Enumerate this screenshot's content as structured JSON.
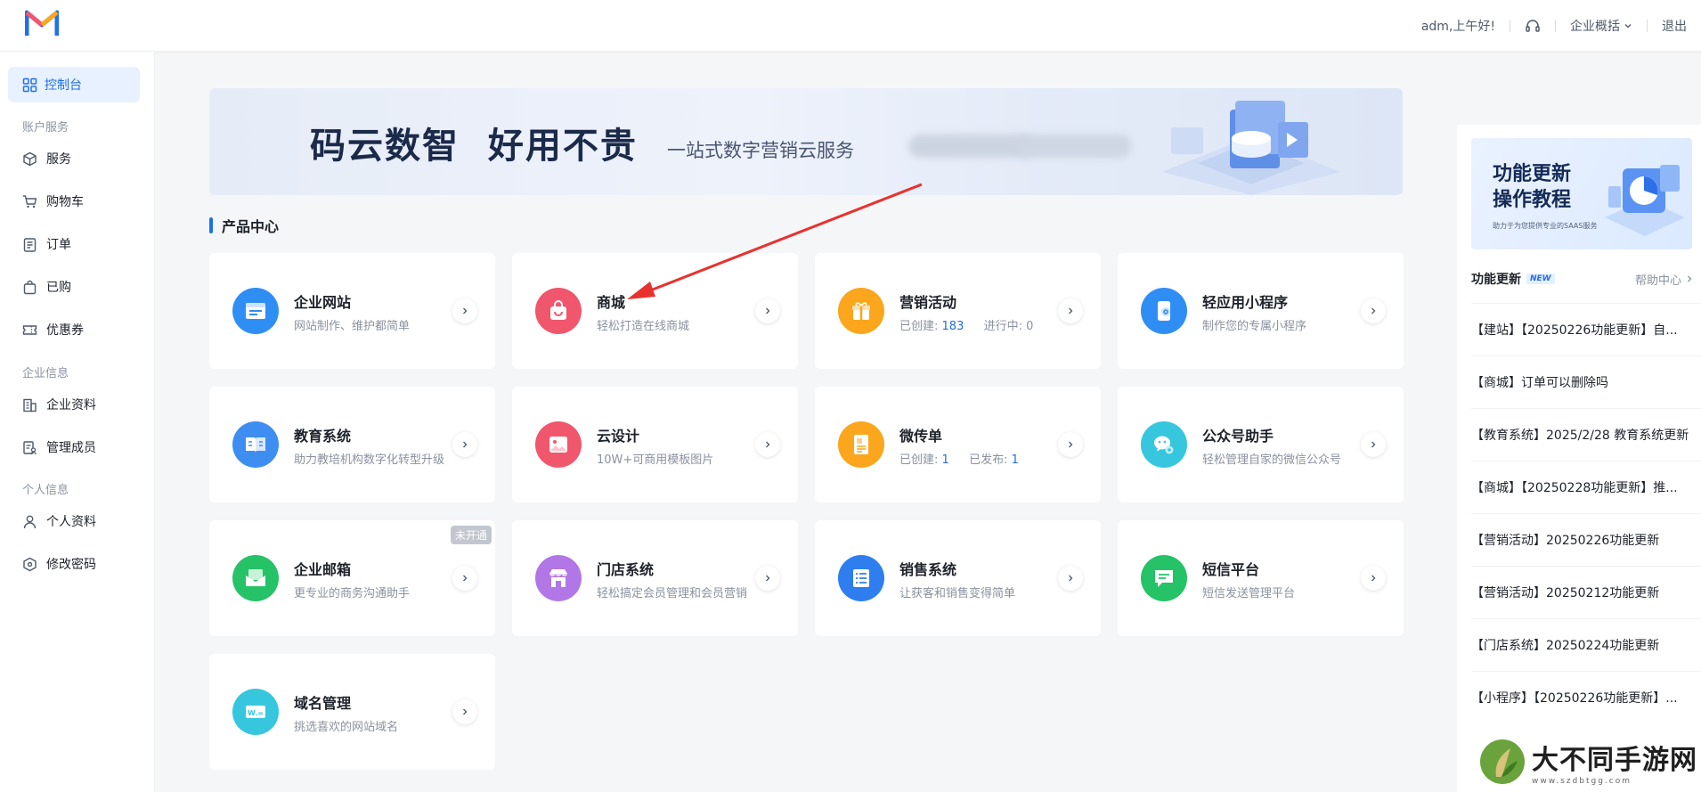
{
  "header": {
    "greeting": "adm,上午好!",
    "overview": "企业概括",
    "logout": "退出"
  },
  "sidebar": {
    "dashboard": "控制台",
    "groups": {
      "account": "账户服务",
      "company": "企业信息",
      "personal": "个人信息"
    },
    "items": [
      {
        "label": "服务",
        "icon": "box-icon"
      },
      {
        "label": "购物车",
        "icon": "cart-icon"
      },
      {
        "label": "订单",
        "icon": "order-icon"
      },
      {
        "label": "已购",
        "icon": "bag-icon"
      },
      {
        "label": "优惠券",
        "icon": "coupon-icon"
      },
      {
        "label": "企业资料",
        "icon": "building-icon"
      },
      {
        "label": "管理成员",
        "icon": "members-icon"
      },
      {
        "label": "个人资料",
        "icon": "user-icon"
      },
      {
        "label": "修改密码",
        "icon": "password-icon"
      }
    ]
  },
  "banner": {
    "title": "码云数智  好用不贵",
    "subtitle": "一站式数字营销云服务"
  },
  "products": {
    "section_title": "产品中心",
    "cards": [
      {
        "name": "企业网站",
        "desc": "网站制作、维护都简单",
        "color": "#2f8ef4"
      },
      {
        "name": "商城",
        "desc": "轻松打造在线商城",
        "color": "#f0566c"
      },
      {
        "name": "营销活动",
        "desc_a": "已创建:",
        "num_a": "183",
        "desc_b": "进行中:",
        "num_b": "0",
        "color": "#fba61c"
      },
      {
        "name": "轻应用小程序",
        "desc": "制作您的专属小程序",
        "color": "#2f8ef4"
      },
      {
        "name": "教育系统",
        "desc": "助力教培机构数字化转型升级",
        "color": "#3d8ef0"
      },
      {
        "name": "云设计",
        "desc": "10W+可商用模板图片",
        "color": "#f0566c"
      },
      {
        "name": "微传单",
        "desc_a": "已创建:",
        "num_a": "1",
        "desc_b": "已发布:",
        "num_b": "1",
        "color": "#fba61c"
      },
      {
        "name": "公众号助手",
        "desc": "轻松管理自家的微信公众号",
        "color": "#36c6de"
      },
      {
        "name": "企业邮箱",
        "desc": "更专业的商务沟通助手",
        "badge": "未开通",
        "color": "#25c267"
      },
      {
        "name": "门店系统",
        "desc": "轻松搞定会员管理和会员营销",
        "color": "#b277e6"
      },
      {
        "name": "销售系统",
        "desc": "让获客和销售变得简单",
        "color": "#2f7ef0"
      },
      {
        "name": "短信平台",
        "desc": "短信发送管理平台",
        "color": "#25c267"
      },
      {
        "name": "域名管理",
        "desc": "挑选喜欢的网站域名",
        "color": "#36c6de"
      }
    ]
  },
  "right_panel": {
    "banner_title_1": "功能更新",
    "banner_title_2": "操作教程",
    "banner_sub": "助力于为您提供专业的SAAS服务",
    "updates_title": "功能更新",
    "new_tag": "NEW",
    "help_link": "帮助中心",
    "updates": [
      "【建站】【20250226功能更新】自...",
      "【商城】订单可以删除吗",
      "【教育系统】2025/2/28 教育系统更新",
      "【商城】【20250228功能更新】推...",
      "【营销活动】20250226功能更新",
      "【营销活动】20250212功能更新",
      "【门店系统】20250224功能更新",
      "【小程序】【20250226功能更新】..."
    ]
  },
  "watermark": {
    "big": "大不同手游网",
    "small": "www.szdbtgg.com"
  }
}
